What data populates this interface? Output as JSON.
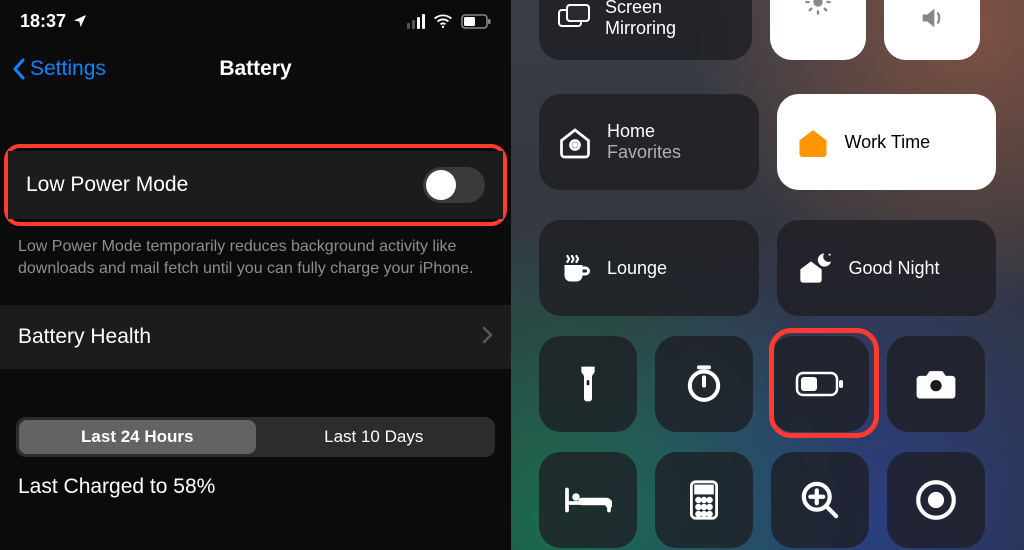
{
  "left": {
    "status": {
      "time": "18:37"
    },
    "nav": {
      "back": "Settings",
      "title": "Battery"
    },
    "lowpower": {
      "label": "Low Power Mode",
      "desc": "Low Power Mode temporarily reduces background activity like downloads and mail fetch until you can fully charge your iPhone."
    },
    "battery_health": "Battery Health",
    "segmented": {
      "a": "Last 24 Hours",
      "b": "Last 10 Days"
    },
    "charged": "Last Charged to 58%"
  },
  "right": {
    "screen_mirroring_l1": "Screen",
    "screen_mirroring_l2": "Mirroring",
    "home_l1": "Home",
    "home_l2": "Favorites",
    "work_time": "Work Time",
    "lounge": "Lounge",
    "good_night": "Good Night"
  }
}
